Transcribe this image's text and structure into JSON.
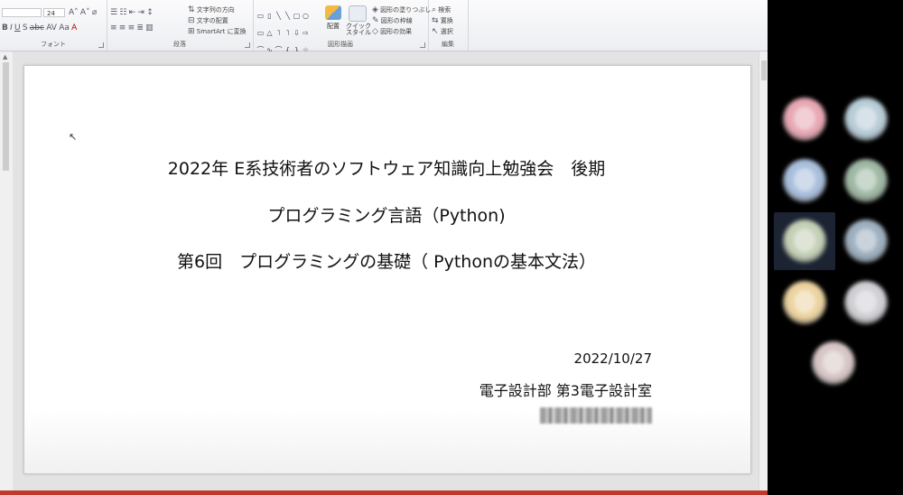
{
  "ribbon": {
    "font_group": "フォント",
    "paragraph_group": "段落",
    "drawing_group": "図形描画",
    "editing_group": "編集",
    "font_size": "24",
    "text_direction": "文字列の方向",
    "align_text": "文字の配置",
    "smartart": "SmartArt に変換",
    "arrange": "配置",
    "quick_styles": "クイック\nスタイル",
    "shape_fill": "図形の塗りつぶし",
    "shape_outline": "図形の枠線",
    "shape_effects": "図形の効果",
    "find": "検索",
    "replace": "置換",
    "select": "選択"
  },
  "slide": {
    "title_line1": "2022年 E系技術者のソフトウェア知識向上勉強会　後期",
    "title_line2": "プログラミング言語（Python)",
    "title_line3": "第6回　プログラミングの基礎（ Pythonの基本文法）",
    "date": "2022/10/27",
    "department": "電子設計部 第3電子設計室"
  },
  "participants": {
    "colors": [
      "#e8a8b4",
      "#b8cdd8",
      "#a9bfdc",
      "#9fb8a4",
      "#c4d0b6",
      "#9eb0c0",
      "#ecd3a0",
      "#d0d0d4",
      "#d8c6c6"
    ]
  }
}
